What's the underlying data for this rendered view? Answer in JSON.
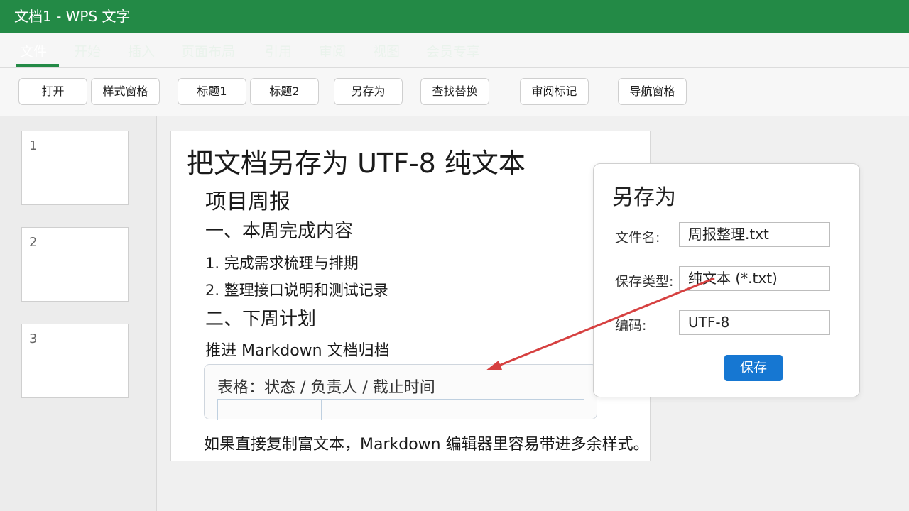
{
  "window": {
    "title": "文档1 - WPS 文字"
  },
  "menu": {
    "tabs": [
      {
        "label": "文件"
      },
      {
        "label": "开始"
      },
      {
        "label": "插入"
      },
      {
        "label": "页面布局"
      },
      {
        "label": "引用"
      },
      {
        "label": "审阅"
      },
      {
        "label": "视图"
      },
      {
        "label": "会员专享"
      }
    ],
    "active_tab": "文件"
  },
  "toolbar": {
    "buttons": [
      {
        "label": "打开"
      },
      {
        "label": "样式窗格"
      },
      {
        "label": "标题1"
      },
      {
        "label": "标题2"
      },
      {
        "label": "另存为"
      },
      {
        "label": "查找替换"
      },
      {
        "label": "审阅标记"
      },
      {
        "label": "导航窗格"
      }
    ]
  },
  "sidebar": {
    "pages": [
      {
        "number": "1"
      },
      {
        "number": "2"
      },
      {
        "number": "3"
      }
    ]
  },
  "document": {
    "title": "把文档另存为 UTF-8 纯文本",
    "report_heading": "项目周报",
    "section1": "一、本周完成内容",
    "item1": "1. 完成需求梳理与排期",
    "item2": "2. 整理接口说明和测试记录",
    "section2": "二、下周计划",
    "plan": "推进 Markdown 文档归档",
    "table_caption": "表格：状态 / 负责人 / 截止时间",
    "note": "如果直接复制富文本，Markdown 编辑器里容易带进多余样式。"
  },
  "dialog": {
    "title": "另存为",
    "filename_label": "文件名:",
    "filename_value": "周报整理.txt",
    "type_label": "保存类型:",
    "type_value": "纯文本 (*.txt)",
    "encoding_label": "编码:",
    "encoding_value": "UTF-8",
    "save_label": "保存"
  },
  "colors": {
    "brand_green": "#238a46",
    "save_blue": "#1677d2",
    "arrow_red": "#d64040"
  }
}
